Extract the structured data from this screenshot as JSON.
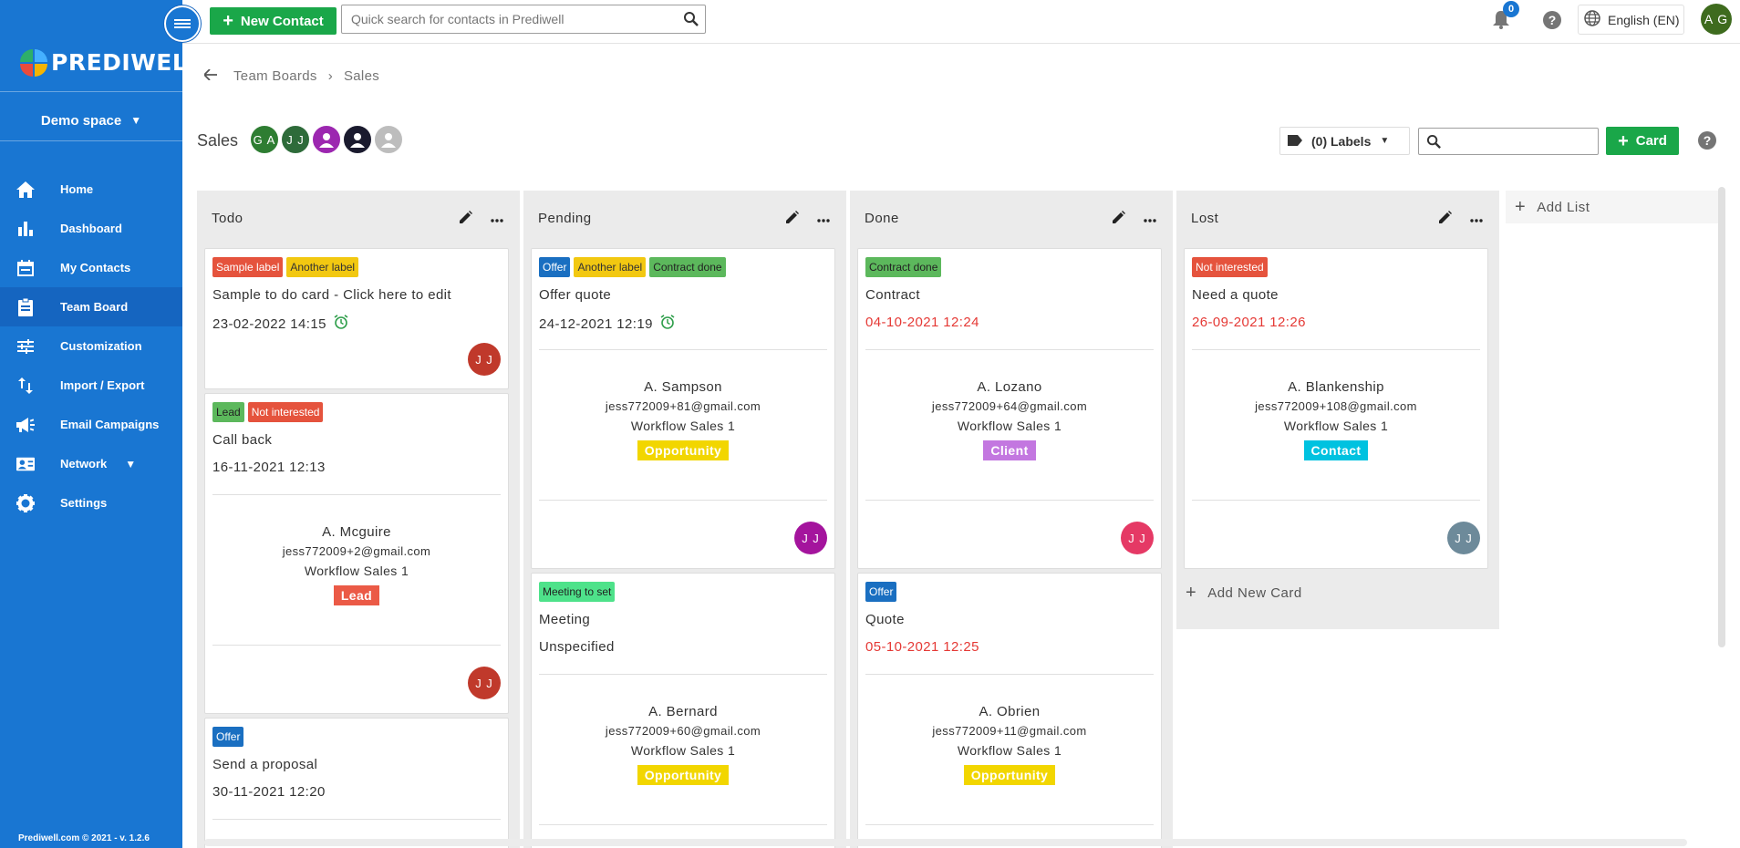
{
  "sidebar": {
    "logo_text": "PREDIWELL",
    "space": "Demo space",
    "items": [
      {
        "label": "Home",
        "icon": "home-icon"
      },
      {
        "label": "Dashboard",
        "icon": "bar-chart-icon"
      },
      {
        "label": "My Contacts",
        "icon": "calendar-icon"
      },
      {
        "label": "Team Board",
        "icon": "clipboard-icon"
      },
      {
        "label": "Customization",
        "icon": "sliders-icon"
      },
      {
        "label": "Import / Export",
        "icon": "import-export-icon"
      },
      {
        "label": "Email Campaigns",
        "icon": "megaphone-icon"
      },
      {
        "label": "Network",
        "icon": "contact-card-icon"
      },
      {
        "label": "Settings",
        "icon": "gear-icon"
      }
    ],
    "active": "Team Board",
    "footer": "Prediwell.com © 2021 - v. 1.2.6"
  },
  "topbar": {
    "new_contact": "New Contact",
    "search_placeholder": "Quick search for contacts in Prediwell",
    "notifications": "0",
    "language": "English (EN)",
    "user_initials": "A G"
  },
  "breadcrumb": {
    "parent": "Team Boards",
    "current": "Sales"
  },
  "board": {
    "title": "Sales",
    "members": [
      {
        "initials": "G A",
        "color": "#2e7d32"
      },
      {
        "initials": "J J",
        "color": "#2e6b3a"
      },
      {
        "initials": "",
        "color": "#9c27b0"
      },
      {
        "initials": "",
        "color": "#1a1a2e"
      },
      {
        "initials": "",
        "color": "#bdbdbd"
      }
    ],
    "labels_button": "(0) Labels",
    "card_button": "Card",
    "add_list": "Add List",
    "add_new_card": "Add New Card"
  },
  "lists": [
    {
      "name": "Todo",
      "cards": [
        {
          "tags": [
            {
              "text": "Sample label",
              "color": "red"
            },
            {
              "text": "Another label",
              "color": "yellow"
            }
          ],
          "title": "Sample to do card - Click here to edit",
          "date": "23-02-2022 14:15",
          "alarm": true,
          "overdue": false,
          "assignee": {
            "initials": "J J",
            "color": "#c0392b"
          }
        },
        {
          "tags": [
            {
              "text": "Lead",
              "color": "green"
            },
            {
              "text": "Not interested",
              "color": "red"
            }
          ],
          "title": "Call back",
          "date": "16-11-2021 12:13",
          "overdue": false,
          "contact": {
            "name": "A. Mcguire",
            "email": "jess772009+2@gmail.com",
            "workflow": "Workflow Sales 1",
            "status": "Lead"
          },
          "assignee": {
            "initials": "J J",
            "color": "#c0392b"
          }
        },
        {
          "tags": [
            {
              "text": "Offer",
              "color": "blue"
            }
          ],
          "title": "Send a proposal",
          "date": "30-11-2021 12:20",
          "overdue": false
        }
      ]
    },
    {
      "name": "Pending",
      "cards": [
        {
          "tags": [
            {
              "text": "Offer",
              "color": "blue"
            },
            {
              "text": "Another label",
              "color": "yellow"
            },
            {
              "text": "Contract done",
              "color": "green"
            }
          ],
          "title": "Offer quote",
          "date": "24-12-2021 12:19",
          "alarm": true,
          "overdue": false,
          "contact": {
            "name": "A. Sampson",
            "email": "jess772009+81@gmail.com",
            "workflow": "Workflow Sales 1",
            "status": "Opportunity"
          },
          "assignee": {
            "initials": "J J",
            "color": "#a4149d"
          }
        },
        {
          "tags": [
            {
              "text": "Meeting to set",
              "color": "mint"
            }
          ],
          "title": "Meeting",
          "date": "Unspecified",
          "overdue": false,
          "contact": {
            "name": "A. Bernard",
            "email": "jess772009+60@gmail.com",
            "workflow": "Workflow Sales 1",
            "status": "Opportunity"
          }
        }
      ]
    },
    {
      "name": "Done",
      "cards": [
        {
          "tags": [
            {
              "text": "Contract done",
              "color": "green"
            }
          ],
          "title": "Contract",
          "date": "04-10-2021 12:24",
          "overdue": true,
          "contact": {
            "name": "A. Lozano",
            "email": "jess772009+64@gmail.com",
            "workflow": "Workflow Sales 1",
            "status": "Client"
          },
          "assignee": {
            "initials": "J J",
            "color": "#e53965"
          }
        },
        {
          "tags": [
            {
              "text": "Offer",
              "color": "blue"
            }
          ],
          "title": "Quote",
          "date": "05-10-2021 12:25",
          "overdue": true,
          "contact": {
            "name": "A. Obrien",
            "email": "jess772009+11@gmail.com",
            "workflow": "Workflow Sales 1",
            "status": "Opportunity"
          }
        }
      ]
    },
    {
      "name": "Lost",
      "cards": [
        {
          "tags": [
            {
              "text": "Not interested",
              "color": "red"
            }
          ],
          "title": "Need a quote",
          "date": "26-09-2021 12:26",
          "overdue": true,
          "contact": {
            "name": "A. Blankenship",
            "email": "jess772009+108@gmail.com",
            "workflow": "Workflow Sales 1",
            "status": "Contact"
          },
          "assignee": {
            "initials": "J J",
            "color": "#6d8a9a"
          }
        }
      ]
    }
  ]
}
